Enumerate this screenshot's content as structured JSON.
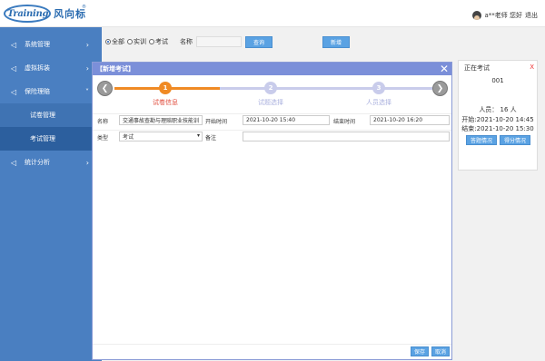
{
  "header": {
    "logo_word": "Training",
    "logo_cn": "风向标",
    "logo_reg": "®",
    "user_greeting": "a**老师 您好",
    "logout": "退出"
  },
  "sidebar": {
    "items": [
      {
        "label": "系统管理",
        "icon": "send-icon",
        "chevron": "›"
      },
      {
        "label": "虚拟拆装",
        "icon": "send-icon",
        "chevron": "›"
      },
      {
        "label": "保险理赔",
        "icon": "send-icon",
        "chevron": "˅"
      },
      {
        "label": "统计分析",
        "icon": "send-icon",
        "chevron": "›"
      }
    ],
    "subitems": [
      {
        "label": "试卷管理"
      },
      {
        "label": "考试管理"
      }
    ]
  },
  "filters": {
    "radio_all": "全部",
    "radio_practice": "实训",
    "radio_exam": "考试",
    "name_label": "名称",
    "query_btn": "查询",
    "add_btn": "新增"
  },
  "exam_card": {
    "title": "正在考试",
    "close": "X",
    "code": "001",
    "people": "人员： 16 人",
    "start": "开始:2021-10-20 14:45",
    "end": "结束:2021-10-20 15:30",
    "btn_answer": "答题情况",
    "btn_score": "得分情况"
  },
  "modal": {
    "title": "【新增考试】",
    "close": "✕",
    "steps": [
      {
        "num": "1",
        "label": "试卷信息"
      },
      {
        "num": "2",
        "label": "试题选择"
      },
      {
        "num": "3",
        "label": "人员选择"
      }
    ],
    "form": {
      "name_label": "名称",
      "name_value": "交通事故查勘与理赔职业技能训",
      "start_label": "开始时间",
      "start_value": "2021-10-20 15:40",
      "end_label": "结束时间",
      "end_value": "2021-10-20 16:20",
      "type_label": "类型",
      "type_value": "考试",
      "remark_label": "备注",
      "remark_value": ""
    },
    "save": "保存",
    "cancel": "取消"
  },
  "colors": {
    "sidebar": "#4a7fc1",
    "accent_orange": "#f08a24",
    "modal_header": "#7b8fd9",
    "button_blue": "#5aa2e3"
  }
}
